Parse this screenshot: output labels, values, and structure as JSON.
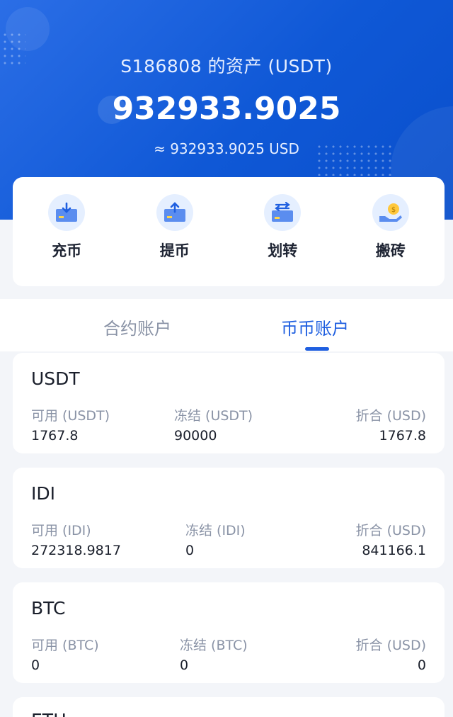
{
  "header": {
    "title": "S186808 的资产 (USDT)",
    "total": "932933.9025",
    "approx_usd": "≈ 932933.9025 USD"
  },
  "actions": [
    {
      "label": "充币",
      "icon": "deposit-icon"
    },
    {
      "label": "提币",
      "icon": "withdraw-icon"
    },
    {
      "label": "划转",
      "icon": "transfer-icon"
    },
    {
      "label": "搬砖",
      "icon": "money-hand-icon"
    }
  ],
  "tabs": [
    {
      "label": "合约账户",
      "active": false
    },
    {
      "label": "币币账户",
      "active": true
    }
  ],
  "accent_color": "#1f5fe0",
  "assets": [
    {
      "symbol": "USDT",
      "available_label": "可用 (USDT)",
      "frozen_label": "冻结 (USDT)",
      "equiv_label": "折合 (USD)",
      "available": "1767.8",
      "frozen": "90000",
      "equiv": "1767.8"
    },
    {
      "symbol": "IDI",
      "available_label": "可用 (IDI)",
      "frozen_label": "冻结 (IDI)",
      "equiv_label": "折合 (USD)",
      "available": "272318.9817",
      "frozen": "0",
      "equiv": "841166.1"
    },
    {
      "symbol": "BTC",
      "available_label": "可用 (BTC)",
      "frozen_label": "冻结 (BTC)",
      "equiv_label": "折合 (USD)",
      "available": "0",
      "frozen": "0",
      "equiv": "0"
    },
    {
      "symbol": "ETH"
    }
  ]
}
